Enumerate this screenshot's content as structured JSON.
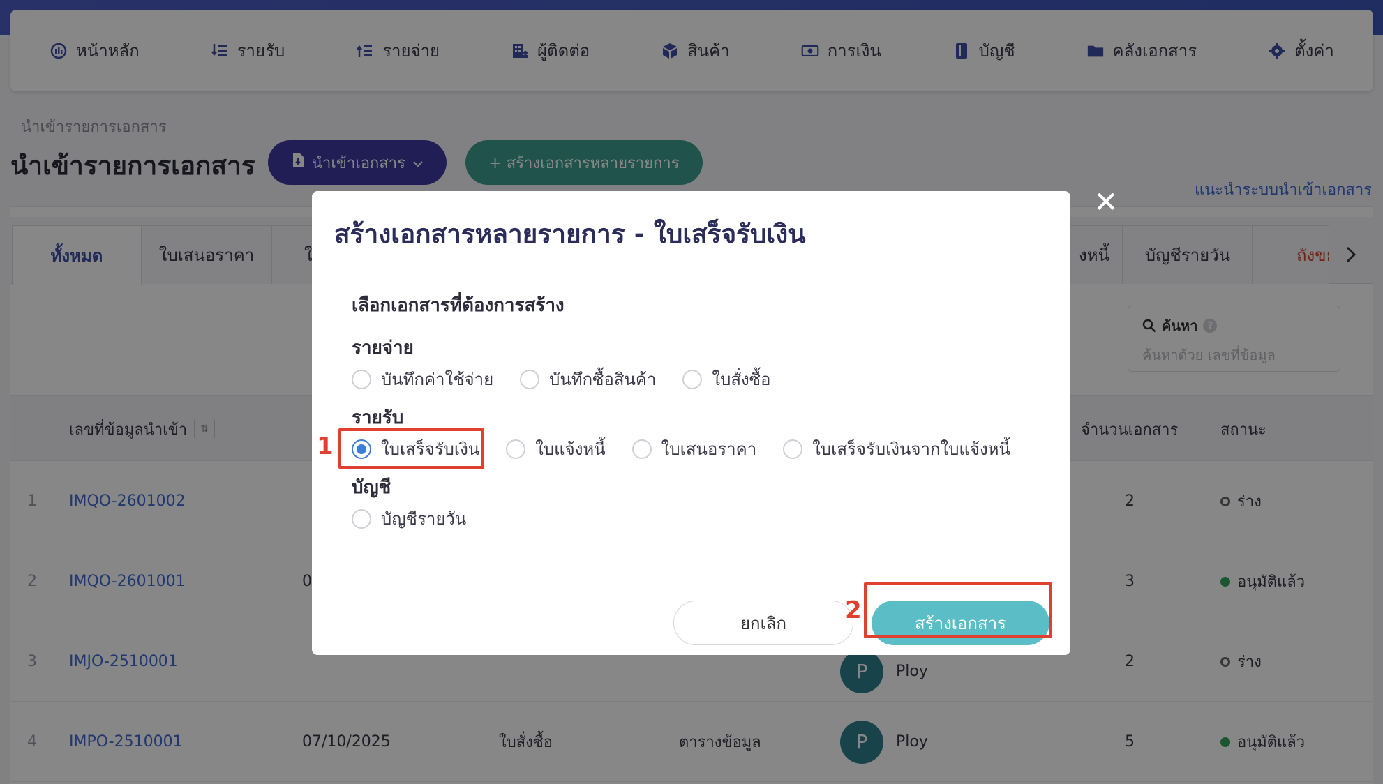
{
  "nav": {
    "items": [
      {
        "label": "หน้าหลัก",
        "icon": "dashboard-icon"
      },
      {
        "label": "รายรับ",
        "icon": "income-list-icon"
      },
      {
        "label": "รายจ่าย",
        "icon": "expense-list-icon"
      },
      {
        "label": "ผู้ติดต่อ",
        "icon": "contacts-building-icon"
      },
      {
        "label": "สินค้า",
        "icon": "product-box-icon"
      },
      {
        "label": "การเงิน",
        "icon": "money-icon"
      },
      {
        "label": "บัญชี",
        "icon": "ledger-book-icon"
      },
      {
        "label": "คลังเอกสาร",
        "icon": "folder-icon"
      },
      {
        "label": "ตั้งค่า",
        "icon": "gear-icon"
      }
    ]
  },
  "page": {
    "breadcrumb": "นำเข้ารายการเอกสาร",
    "title": "นำเข้ารายการเอกสาร",
    "import_button": "นำเข้าเอกสาร",
    "bulk_button": "+ สร้างเอกสารหลายรายการ",
    "help_link": "แนะนำระบบนำเข้าเอกสาร"
  },
  "tabs": {
    "all": "ทั้งหมด",
    "quotation": "ใบเสนอราคา",
    "cut_left": "ใ",
    "cut_right": "งหนี้",
    "daily_ledger": "บัญชีรายวัน",
    "trash": "ถังขยะ"
  },
  "search": {
    "title": "ค้นหา",
    "placeholder": "ค้นหาด้วย เลขที่ข้อมูล"
  },
  "table": {
    "col_import_no": "เลขที่ข้อมูลนำเข้า",
    "col_doc_count": "จำนวนเอกสาร",
    "col_status": "สถานะ",
    "rows": [
      {
        "idx": "1",
        "code": "IMQO-2601002",
        "date": "",
        "type": "",
        "source": "",
        "user": "",
        "count": "2",
        "status": "ร่าง",
        "status_kind": "draft"
      },
      {
        "idx": "2",
        "code": "IMQO-2601001",
        "date": "0",
        "type": "",
        "source": "",
        "user": "",
        "count": "3",
        "status": "อนุมัติแล้ว",
        "status_kind": "ok"
      },
      {
        "idx": "3",
        "code": "IMJO-2510001",
        "date": "",
        "type": "",
        "source": "",
        "user": "Ploy",
        "count": "2",
        "status": "ร่าง",
        "status_kind": "draft"
      },
      {
        "idx": "4",
        "code": "IMPO-2510001",
        "date": "07/10/2025",
        "type": "ใบสั่งซื้อ",
        "source": "ตารางข้อมูล",
        "user": "Ploy",
        "count": "5",
        "status": "อนุมัติแล้ว",
        "status_kind": "ok"
      }
    ],
    "avatar_letter": "P"
  },
  "modal": {
    "title": "สร้างเอกสารหลายรายการ - ใบเสร็จรับเงิน",
    "section_title": "เลือกเอกสารที่ต้องการสร้าง",
    "groups": {
      "expense": {
        "label": "รายจ่าย",
        "options": [
          "บันทึกค่าใช้จ่าย",
          "บันทึกซื้อสินค้า",
          "ใบสั่งซื้อ"
        ]
      },
      "income": {
        "label": "รายรับ",
        "options": [
          "ใบเสร็จรับเงิน",
          "ใบแจ้งหนี้",
          "ใบเสนอราคา",
          "ใบเสร็จรับเงินจากใบแจ้งหนี้"
        ],
        "selected": "ใบเสร็จรับเงิน"
      },
      "account": {
        "label": "บัญชี",
        "options": [
          "บัญชีรายวัน"
        ]
      }
    },
    "cancel_button": "ยกเลิก",
    "create_button": "สร้างเอกสาร",
    "close_symbol": "✕"
  },
  "annotations": {
    "step1": "1",
    "step2": "2",
    "color": "#e0412e"
  }
}
